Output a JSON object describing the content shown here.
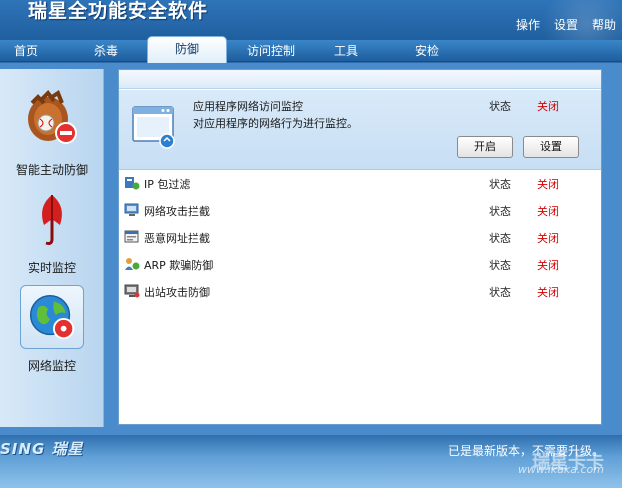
{
  "app": {
    "title": "瑞星全功能安全软件",
    "menu": [
      "操作",
      "设置",
      "帮助"
    ]
  },
  "tabs": [
    {
      "label": "首页",
      "active": false
    },
    {
      "label": "杀毒",
      "active": false
    },
    {
      "label": "防御",
      "active": true
    },
    {
      "label": "访问控制",
      "active": false
    },
    {
      "label": "工具",
      "active": false
    },
    {
      "label": "安检",
      "active": false
    }
  ],
  "sidebar": {
    "items": [
      {
        "label": "智能主动防御",
        "icon": "baseball-glove-icon",
        "active": false
      },
      {
        "label": "实时监控",
        "icon": "umbrella-icon",
        "active": false
      },
      {
        "label": "网络监控",
        "icon": "globe-icon",
        "active": true
      }
    ]
  },
  "featured": {
    "title": "应用程序网络访问监控",
    "description": "对应用程序的网络行为进行监控。",
    "status_label": "状态",
    "status_value": "关闭",
    "enable_button": "开启",
    "settings_button": "设置",
    "icon": "app-window-icon"
  },
  "monitors": [
    {
      "label": "IP 包过滤",
      "status_label": "状态",
      "status_value": "关闭",
      "icon": "ip-filter-icon"
    },
    {
      "label": "网络攻击拦截",
      "status_label": "状态",
      "status_value": "关闭",
      "icon": "attack-shield-icon"
    },
    {
      "label": "恶意网址拦截",
      "status_label": "状态",
      "status_value": "关闭",
      "icon": "url-block-icon"
    },
    {
      "label": "ARP 欺骗防御",
      "status_label": "状态",
      "status_value": "关闭",
      "icon": "arp-icon"
    },
    {
      "label": "出站攻击防御",
      "status_label": "状态",
      "status_value": "关闭",
      "icon": "outbound-icon"
    }
  ],
  "footer": {
    "brand": "SING 瑞星",
    "update_status": "已是最新版本，不需要升级。",
    "watermark_logo": "瑞星卡卡",
    "watermark_url": "www.ikaka.com"
  },
  "colors": {
    "status_off": "#d40000",
    "accent": "#2f74b8"
  }
}
